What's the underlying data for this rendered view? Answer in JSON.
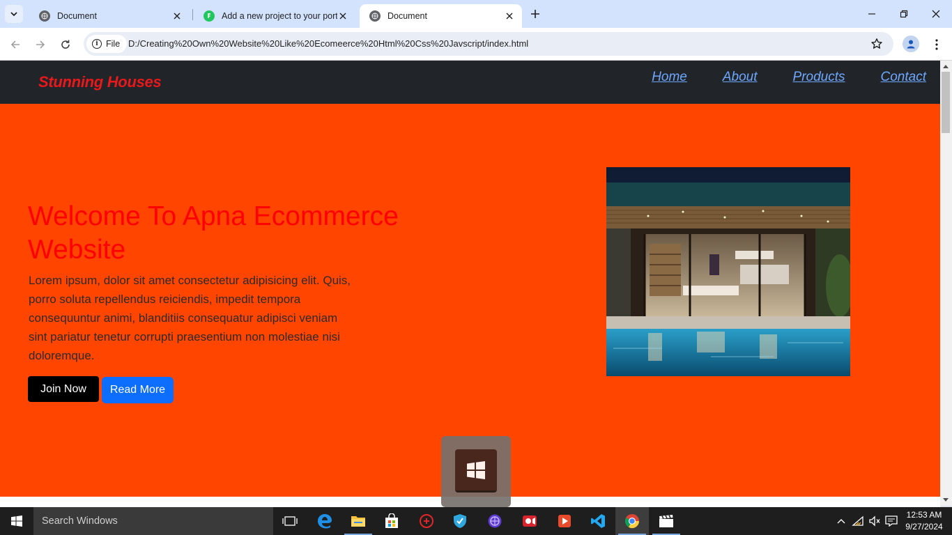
{
  "browser": {
    "tabs": [
      {
        "title": "Document",
        "active": false
      },
      {
        "title": "Add a new project to your portf",
        "active": false
      },
      {
        "title": "Document",
        "active": true
      }
    ],
    "address": {
      "scheme_label": "File",
      "url": "D:/Creating%20Own%20Website%20Like%20Ecomeerce%20Html%20Css%20Javscript/index.html"
    }
  },
  "site": {
    "brand": "Stunning Houses",
    "nav": [
      "Home",
      "About",
      "Products",
      "Contact"
    ],
    "hero": {
      "title": "Welcome To Apna Ecommerce Website",
      "text": "Lorem ipsum, dolor sit amet consectetur adipisicing elit. Quis, porro soluta repellendus reiciendis, impedit tempora consequuntur animi, blanditiis consequatur adipisci veniam sint pariatur tenetur corrupti praesentium non molestiae nisi doloremque.",
      "join_label": "Join Now",
      "read_label": "Read More"
    },
    "colors": {
      "page_bg": "#ff4500",
      "nav_bg": "#212529",
      "brand": "#e8181b",
      "link": "#6ea8fe",
      "title": "#ff0000",
      "primary_button": "#0d6efd"
    }
  },
  "taskbar": {
    "search_placeholder": "Search Windows",
    "time": "12:53 AM",
    "date": "9/27/2024",
    "apps": [
      "task-view",
      "edge",
      "file-explorer",
      "store",
      "game-app",
      "vpn-shield",
      "browser-globe",
      "screen-recorder",
      "media-player",
      "vscode",
      "chrome",
      "clapper"
    ]
  }
}
